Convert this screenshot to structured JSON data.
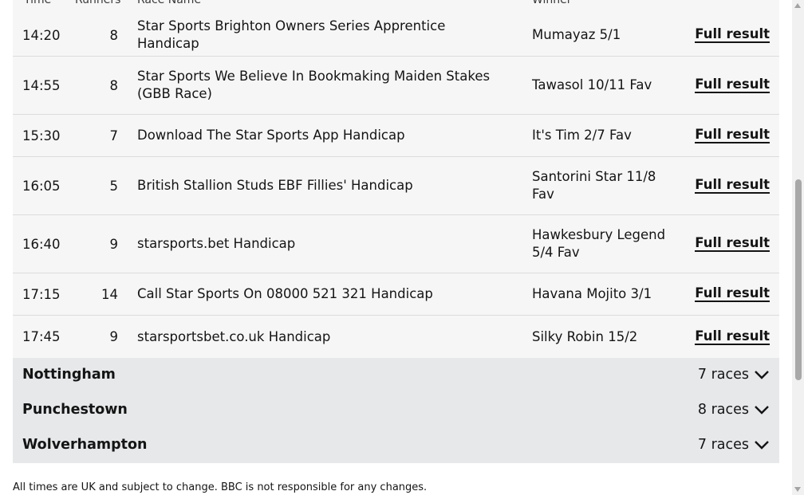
{
  "table_header": {
    "time": "Time",
    "runners": "Runners",
    "race_name": "Race Name",
    "winner": "Winner"
  },
  "races": [
    {
      "time": "14:20",
      "runners": "8",
      "name": "Star Sports Brighton Owners Series Apprentice Handicap",
      "winner": "Mumayaz 5/1",
      "link": "Full result"
    },
    {
      "time": "14:55",
      "runners": "8",
      "name": "Star Sports We Believe In Bookmaking Maiden Stakes (GBB Race)",
      "winner": "Tawasol 10/11 Fav",
      "link": "Full result"
    },
    {
      "time": "15:30",
      "runners": "7",
      "name": "Download The Star Sports App Handicap",
      "winner": "It's Tim 2/7 Fav",
      "link": "Full result"
    },
    {
      "time": "16:05",
      "runners": "5",
      "name": "British Stallion Studs EBF Fillies' Handicap",
      "winner": "Santorini Star 11/8 Fav",
      "link": "Full result"
    },
    {
      "time": "16:40",
      "runners": "9",
      "name": "starsports.bet Handicap",
      "winner": "Hawkesbury Legend 5/4 Fav",
      "link": "Full result"
    },
    {
      "time": "17:15",
      "runners": "14",
      "name": "Call Star Sports On 08000 521 321 Handicap",
      "winner": "Havana Mojito 3/1",
      "link": "Full result"
    },
    {
      "time": "17:45",
      "runners": "9",
      "name": "starsportsbet.co.uk Handicap",
      "winner": "Silky Robin 15/2",
      "link": "Full result"
    }
  ],
  "venues": [
    {
      "name": "Nottingham",
      "count": "7 races"
    },
    {
      "name": "Punchestown",
      "count": "8 races"
    },
    {
      "name": "Wolverhampton",
      "count": "7 races"
    }
  ],
  "footnote": "All times are UK and subject to change. BBC is not responsible for any changes.",
  "icons": {
    "expand": "chevron-down-icon"
  }
}
